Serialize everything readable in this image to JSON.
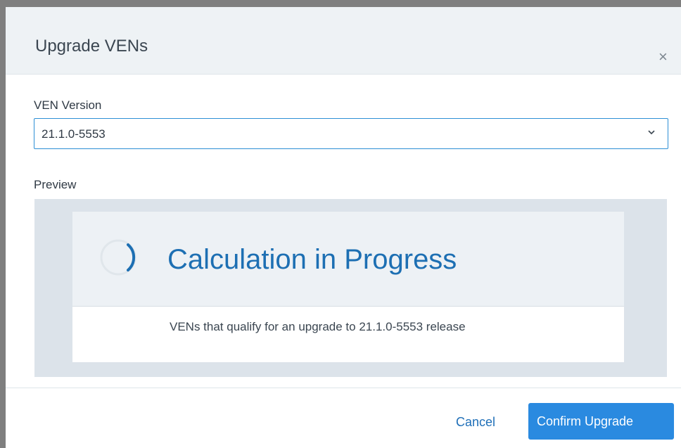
{
  "dialog": {
    "title": "Upgrade VENs",
    "close_label": "×"
  },
  "ven_version": {
    "label": "VEN Version",
    "selected_value": "21.1.0-5553"
  },
  "preview": {
    "label": "Preview",
    "status_title": "Calculation in Progress",
    "description": "VENs that qualify for an upgrade to 21.1.0-5553 release"
  },
  "footer": {
    "cancel_label": "Cancel",
    "confirm_label": "Confirm Upgrade"
  },
  "colors": {
    "accent": "#2a8ae0",
    "title_blue": "#1d6fb3",
    "header_bg": "#eef2f5"
  },
  "icons": {
    "close": "close-icon",
    "dropdown": "chevron-down-icon",
    "loading": "spinner-icon"
  }
}
